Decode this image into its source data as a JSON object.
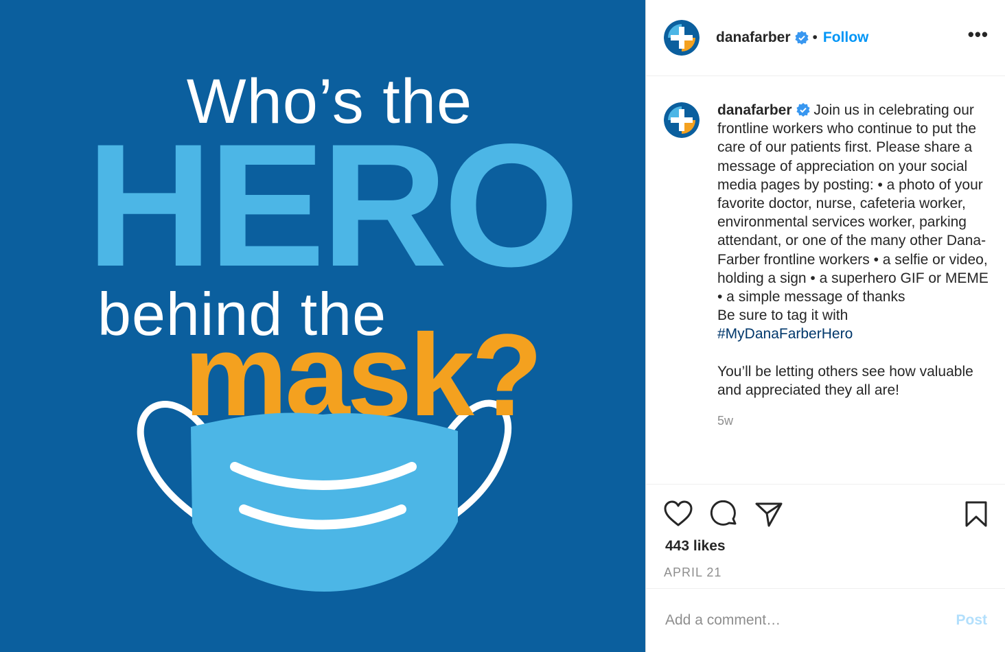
{
  "media": {
    "line1": "Who’s the",
    "line2": "HERO",
    "line3": "behind the",
    "line4": "mask?",
    "colors": {
      "background": "#0b5f9e",
      "light_blue": "#4cb6e6",
      "orange": "#f4a11f"
    }
  },
  "header": {
    "username": "danafarber",
    "separator": "•",
    "follow_label": "Follow",
    "more_label": "•••"
  },
  "caption": {
    "username": "danafarber",
    "text": "Join us in celebrating our frontline workers who continue to put the care of our patients first. Please share a message of appreciation on your social media pages by posting: • a photo of your favorite doctor, nurse, cafeteria worker, environmental services worker, parking attendant, or one of the many other Dana-Farber frontline workers • a selfie or video, holding a sign • a superhero GIF or MEME\n• a simple message of thanks\nBe sure to tag it with\n",
    "hashtag": "#MyDanaFarberHero",
    "text_after": "\n\nYou’ll be letting others see how valuable and appreciated they all are!",
    "time": "5w"
  },
  "actions": {
    "icons": [
      "heart-icon",
      "comment-icon",
      "share-icon",
      "bookmark-icon"
    ],
    "likes": "443 likes",
    "date": "APRIL 21"
  },
  "comment": {
    "placeholder": "Add a comment…",
    "post_label": "Post"
  }
}
